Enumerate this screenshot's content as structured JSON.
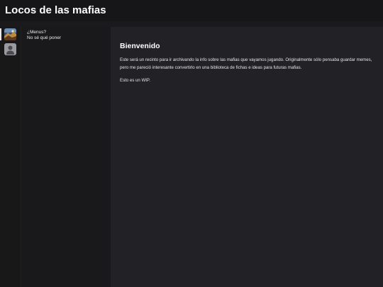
{
  "header": {
    "title": "Locos de las mafias"
  },
  "rail": {
    "items": [
      {
        "icon": "game-cover-icon",
        "active": true
      },
      {
        "icon": "default-avatar-icon",
        "active": false
      }
    ]
  },
  "menu": {
    "line1": "¿Menus?",
    "line2": "No sé qué poner"
  },
  "content": {
    "title": "Bienvenido",
    "paragraphs": [
      "Este será un recinto para ir archivando la info sobre las mafias que vayamos jugando. Originalmente sólo pensaba guardar memes, pero me pareció interesante convertirlo en una biblioteca de fichas e ideas para futuras mafias.",
      "Esto es un WIP."
    ]
  },
  "colors": {
    "header_bg": "#161618",
    "page_bg": "#1a1a1c",
    "content_bg": "#222226",
    "text": "#ffffff"
  }
}
